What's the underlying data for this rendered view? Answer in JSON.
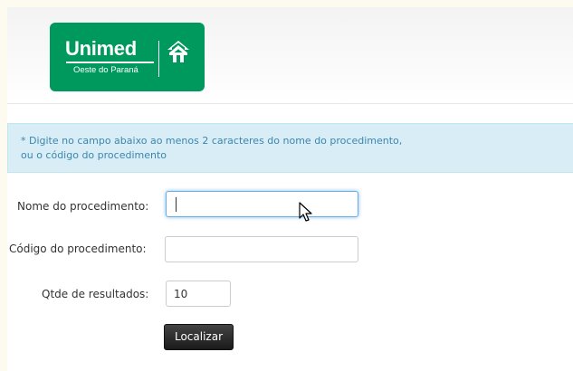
{
  "header": {
    "logo": {
      "brand": "Unimed",
      "region": "Oeste do Paraná"
    }
  },
  "notice": {
    "line1": "* Digite no campo abaixo ao menos 2 caracteres do nome do procedimento,",
    "line2": "ou o código do procedimento"
  },
  "form": {
    "procedure_name": {
      "label": "Nome do procedimento:",
      "value": "",
      "placeholder": ""
    },
    "procedure_code": {
      "label": "Código do procedimento:",
      "value": "",
      "placeholder": ""
    },
    "result_count": {
      "label": "Qtde de resultados:",
      "value": "10"
    },
    "submit_label": "Localizar"
  },
  "icons": {
    "logo_mark": "unimed-tree-icon",
    "cursor": "mouse-pointer-icon"
  },
  "colors": {
    "brand_green": "#00995d",
    "notice_background": "#d9edf7",
    "notice_text": "#3a87ad",
    "button": "#222222"
  }
}
